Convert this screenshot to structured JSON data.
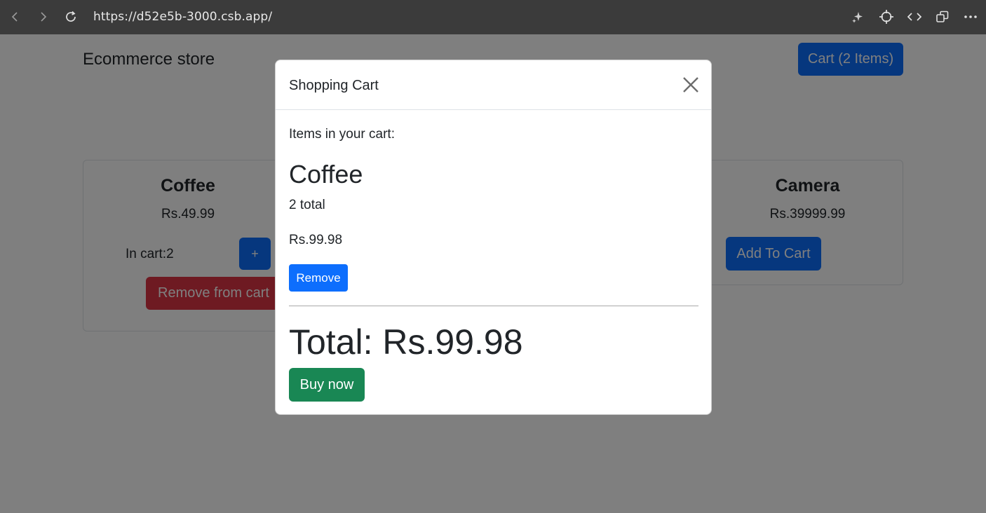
{
  "browser": {
    "url": "https://d52e5b-3000.csb.app/",
    "icons": [
      "back-arrow-icon",
      "forward-arrow-icon",
      "reload-icon",
      "sparkle-icon",
      "crosshair-icon",
      "code-icon",
      "window-icon",
      "more-icon"
    ]
  },
  "header": {
    "brand": "Ecommerce store",
    "cart_button": "Cart (2 Items)"
  },
  "products": [
    {
      "name": "Coffee",
      "price": "Rs.49.99",
      "in_cart_label": "In cart:2",
      "plus_label": "+",
      "remove_label": "Remove from cart"
    },
    {
      "name": "Camera",
      "price": "Rs.39999.99",
      "add_label": "Add To Cart"
    }
  ],
  "modal": {
    "title": "Shopping Cart",
    "items_label": "Items in your cart:",
    "item": {
      "name": "Coffee",
      "quantity": "2 total",
      "total": "Rs.99.98",
      "remove_label": "Remove"
    },
    "grand_total": "Total: Rs.99.98",
    "buy_label": "Buy now"
  },
  "colors": {
    "primary": "#0d6efd",
    "danger": "#dc3545",
    "success": "#198754",
    "chrome": "#3b3b3b"
  }
}
